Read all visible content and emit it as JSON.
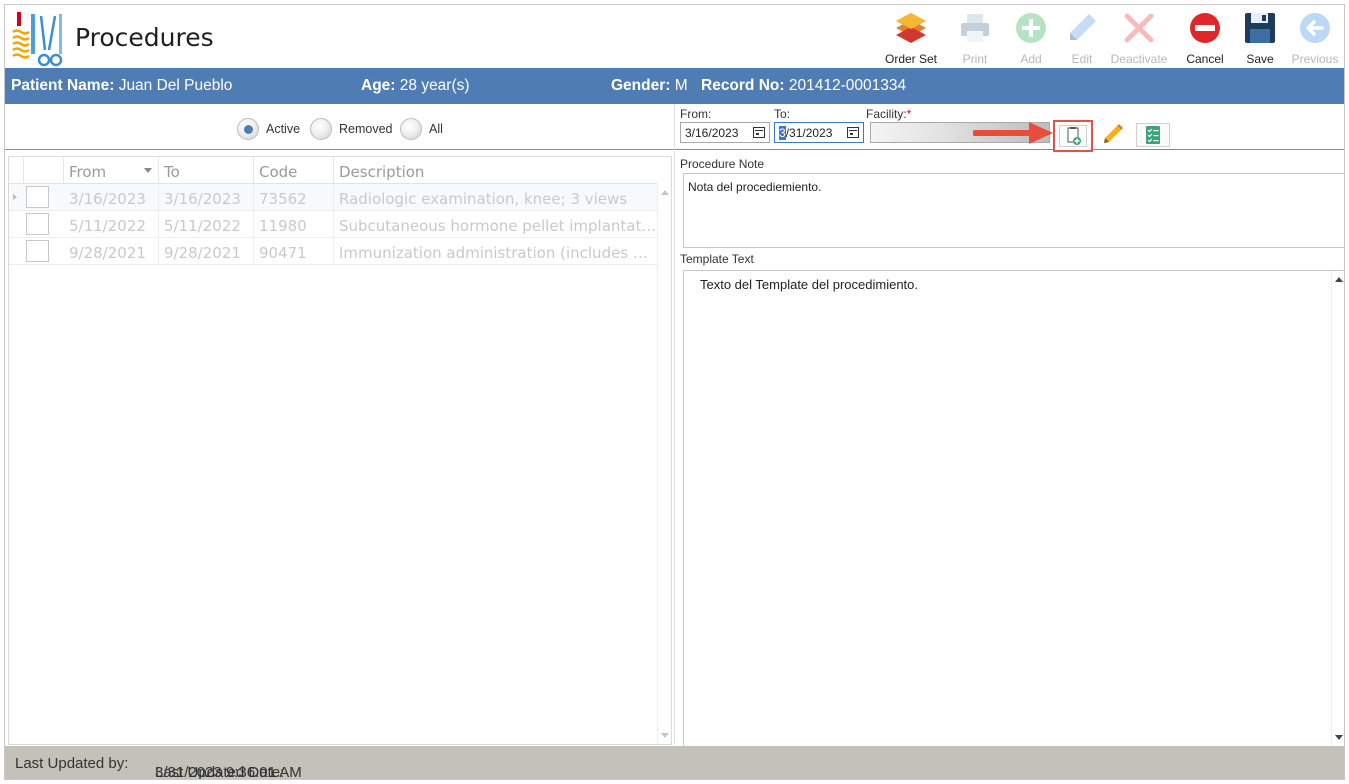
{
  "header": {
    "title": "Procedures",
    "toolbar": [
      {
        "id": "order-set",
        "label": "Order Set",
        "icon": "layers-icon",
        "enabled": true
      },
      {
        "id": "print",
        "label": "Print",
        "icon": "printer-icon",
        "enabled": false
      },
      {
        "id": "add",
        "label": "Add",
        "icon": "plus-circle-icon",
        "enabled": false
      },
      {
        "id": "edit",
        "label": "Edit",
        "icon": "pencil-icon",
        "enabled": false
      },
      {
        "id": "deactivate",
        "label": "Deactivate",
        "icon": "x-icon",
        "enabled": false
      },
      {
        "id": "cancel",
        "label": "Cancel",
        "icon": "cancel-icon",
        "enabled": true
      },
      {
        "id": "save",
        "label": "Save",
        "icon": "floppy-icon",
        "enabled": true
      },
      {
        "id": "previous",
        "label": "Previous",
        "icon": "arrow-left-circle-icon",
        "enabled": false
      }
    ]
  },
  "patient": {
    "name_label": "Patient Name:",
    "name": "Juan Del Pueblo",
    "age_label": "Age:",
    "age": "28 year(s)",
    "gender_label": "Gender:",
    "gender": "M",
    "record_label": "Record No:",
    "record": "201412-0001334"
  },
  "filter": {
    "options": [
      "Active",
      "Removed",
      "All"
    ],
    "selected": "Active"
  },
  "grid": {
    "columns": [
      "From",
      "To",
      "Code",
      "Description"
    ],
    "rows": [
      {
        "from": "3/16/2023",
        "to": "3/16/2023",
        "code": "73562",
        "description": "Radiologic examination, knee; 3 views"
      },
      {
        "from": "5/11/2022",
        "to": "5/11/2022",
        "code": "11980",
        "description": "Subcutaneous hormone pellet implantatio..."
      },
      {
        "from": "9/28/2021",
        "to": "9/28/2021",
        "code": "90471",
        "description": "Immunization administration (includes per..."
      }
    ]
  },
  "date_filter": {
    "from_label": "From:",
    "from_value": "3/16/2023",
    "to_label": "To:",
    "to_value_selected": "3",
    "to_value_rest": "/31/2023",
    "facility_label": "Facility:",
    "facility_required": "*"
  },
  "notes": {
    "procedure_note_label": "Procedure Note",
    "procedure_note_value": "Nota del procediemiento.",
    "template_text_label": "Template Text",
    "template_text_value": "Texto del Template del procedimiento."
  },
  "footer": {
    "updated_by_label": "Last Updated by:",
    "updated_date_label": "Last Updated Date:",
    "updated_date_value": "3/31/2023 9:36:01 AM"
  },
  "colors": {
    "patient_bar": "#4e7cb3",
    "footer": "#c4c1b8",
    "highlight": "#e0524a"
  }
}
